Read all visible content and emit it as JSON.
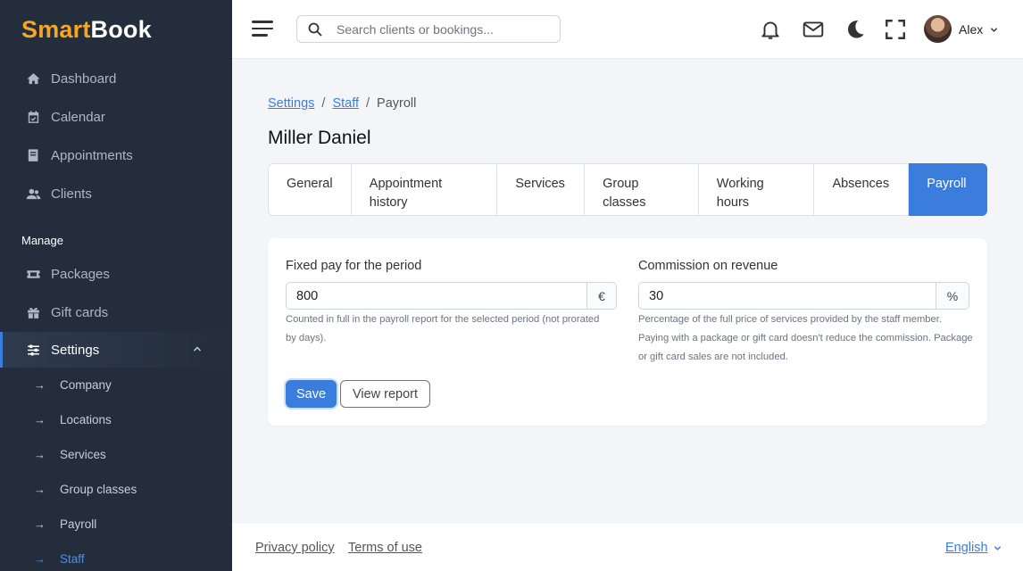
{
  "brand": {
    "part1": "Smart",
    "part2": "Book"
  },
  "sidebar": {
    "main_items": [
      {
        "label": "Dashboard",
        "icon": "home-icon"
      },
      {
        "label": "Calendar",
        "icon": "calendar-check-icon"
      },
      {
        "label": "Appointments",
        "icon": "book-icon"
      },
      {
        "label": "Clients",
        "icon": "users-icon"
      }
    ],
    "section_label": "Manage",
    "manage_items": [
      {
        "label": "Packages",
        "icon": "ticket-icon"
      },
      {
        "label": "Gift cards",
        "icon": "gift-icon"
      },
      {
        "label": "Settings",
        "icon": "sliders-icon",
        "active": true
      }
    ],
    "settings_sub": [
      "Company",
      "Locations",
      "Services",
      "Group classes",
      "Payroll",
      "Staff"
    ],
    "active_sub": "Staff"
  },
  "header": {
    "search_placeholder": "Search clients or bookings...",
    "user_name": "Alex",
    "icons": [
      "menu-icon",
      "search-icon",
      "bell-icon",
      "mail-icon",
      "moon-icon",
      "fullscreen-icon",
      "chevron-down-icon"
    ]
  },
  "breadcrumb": {
    "items": [
      "Settings",
      "Staff"
    ],
    "current": "Payroll"
  },
  "page_title": "Miller Daniel",
  "tabs": [
    {
      "label": "General",
      "active": false
    },
    {
      "label": "Appointment history",
      "active": false
    },
    {
      "label": "Services",
      "active": false
    },
    {
      "label": "Group classes",
      "active": false
    },
    {
      "label": "Working hours",
      "active": false
    },
    {
      "label": "Absences",
      "active": false
    },
    {
      "label": "Payroll",
      "active": true
    }
  ],
  "payroll": {
    "fixed_pay": {
      "label": "Fixed pay for the period",
      "value": "800",
      "unit": "€",
      "help": "Counted in full in the payroll report for the selected period (not prorated by days)."
    },
    "commission": {
      "label": "Commission on revenue",
      "value": "30",
      "unit": "%",
      "help": "Percentage of the full price of services provided by the staff member. Paying with a package or gift card doesn't reduce the commission. Package or gift card sales are not included."
    },
    "save_label": "Save",
    "report_label": "View report"
  },
  "footer": {
    "privacy": "Privacy policy",
    "terms": "Terms of use",
    "language": "English"
  },
  "colors": {
    "primary": "#3b7ddd",
    "sidebar_bg": "#232d3b",
    "brand_accent": "#f5a623"
  }
}
